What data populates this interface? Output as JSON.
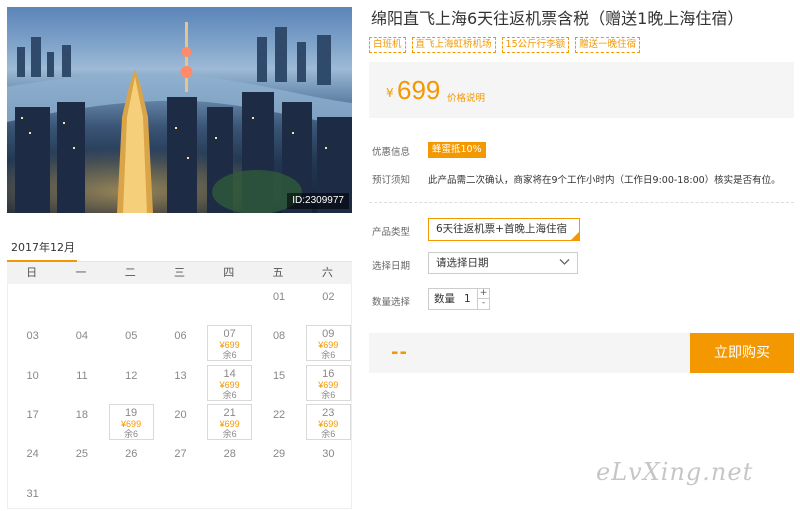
{
  "photo": {
    "id_label": "ID:2309977"
  },
  "calendar": {
    "month": "2017年12月",
    "weekdays": [
      "日",
      "一",
      "二",
      "三",
      "四",
      "五",
      "六"
    ],
    "days": [
      {
        "d": "01",
        "row": 0,
        "col": 5
      },
      {
        "d": "02",
        "row": 0,
        "col": 6
      },
      {
        "d": "03",
        "row": 1,
        "col": 0
      },
      {
        "d": "04",
        "row": 1,
        "col": 1
      },
      {
        "d": "05",
        "row": 1,
        "col": 2
      },
      {
        "d": "06",
        "row": 1,
        "col": 3
      },
      {
        "d": "07",
        "row": 1,
        "col": 4,
        "price": "¥699",
        "stock": "余6"
      },
      {
        "d": "08",
        "row": 1,
        "col": 5
      },
      {
        "d": "09",
        "row": 1,
        "col": 6,
        "price": "¥699",
        "stock": "余6"
      },
      {
        "d": "10",
        "row": 2,
        "col": 0
      },
      {
        "d": "11",
        "row": 2,
        "col": 1
      },
      {
        "d": "12",
        "row": 2,
        "col": 2
      },
      {
        "d": "13",
        "row": 2,
        "col": 3
      },
      {
        "d": "14",
        "row": 2,
        "col": 4,
        "price": "¥699",
        "stock": "余6"
      },
      {
        "d": "15",
        "row": 2,
        "col": 5
      },
      {
        "d": "16",
        "row": 2,
        "col": 6,
        "price": "¥699",
        "stock": "余6"
      },
      {
        "d": "17",
        "row": 3,
        "col": 0
      },
      {
        "d": "18",
        "row": 3,
        "col": 1
      },
      {
        "d": "19",
        "row": 3,
        "col": 2,
        "price": "¥699",
        "stock": "余6"
      },
      {
        "d": "20",
        "row": 3,
        "col": 3
      },
      {
        "d": "21",
        "row": 3,
        "col": 4,
        "price": "¥699",
        "stock": "余6"
      },
      {
        "d": "22",
        "row": 3,
        "col": 5
      },
      {
        "d": "23",
        "row": 3,
        "col": 6,
        "price": "¥699",
        "stock": "余6"
      },
      {
        "d": "24",
        "row": 4,
        "col": 0
      },
      {
        "d": "25",
        "row": 4,
        "col": 1
      },
      {
        "d": "26",
        "row": 4,
        "col": 2
      },
      {
        "d": "27",
        "row": 4,
        "col": 3
      },
      {
        "d": "28",
        "row": 4,
        "col": 4
      },
      {
        "d": "29",
        "row": 4,
        "col": 5
      },
      {
        "d": "30",
        "row": 4,
        "col": 6
      },
      {
        "d": "31",
        "row": 5,
        "col": 0
      }
    ]
  },
  "product": {
    "title": "绵阳直飞上海6天往返机票含税（赠送1晚上海住宿）",
    "tags": [
      "白班机",
      "直飞上海虹桥机场",
      "15公斤行李额",
      "赠送一晚住宿"
    ],
    "price_currency": "¥",
    "price": "699",
    "price_note": "价格说明",
    "promo_label": "优惠信息",
    "promo_badge": "蜂蜜抵10%",
    "notice_label": "预订须知",
    "notice_text": "此产品需二次确认，商家将在9个工作小时内（工作日9:00-18:00）核实是否有位。",
    "type_label": "产品类型",
    "type_option": "6天往返机票+首晚上海住宿",
    "date_label": "选择日期",
    "date_placeholder": "请选择日期",
    "qty_label": "数量选择",
    "qty_prefix": "数量",
    "qty_value": "1",
    "qty_up": "+",
    "qty_down": "-",
    "total": "--",
    "buy_label": "立即购买"
  },
  "watermark": "eLvXing.net",
  "colors": {
    "accent": "#f39800",
    "panel": "#f5f5f5"
  }
}
